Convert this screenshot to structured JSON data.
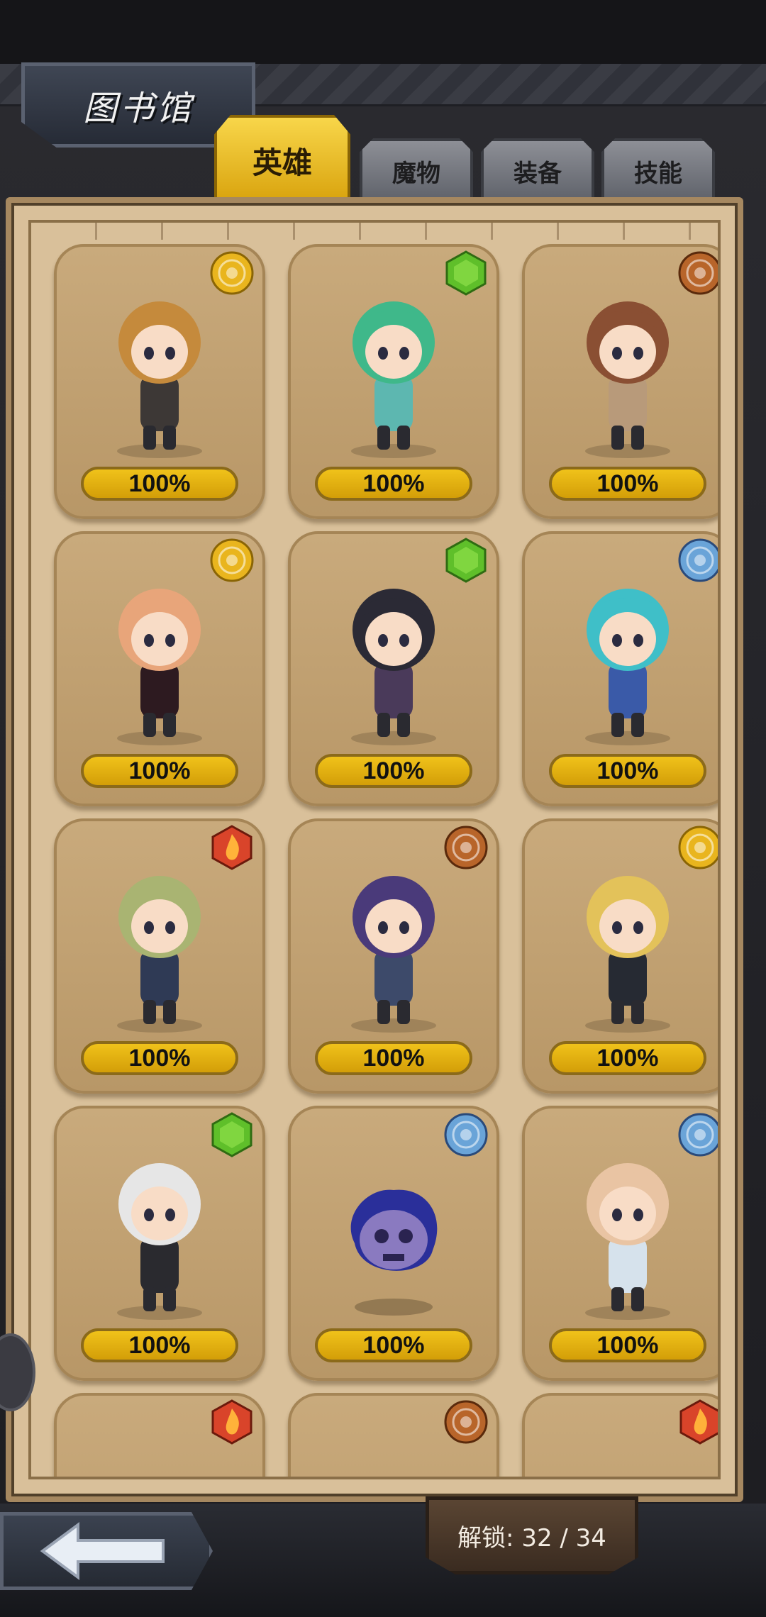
{
  "header": {
    "title": "图书馆"
  },
  "tabs": [
    {
      "label": "英雄",
      "active": true
    },
    {
      "label": "魔物",
      "active": false
    },
    {
      "label": "装备",
      "active": false
    },
    {
      "label": "技能",
      "active": false
    }
  ],
  "colors": {
    "gold": "#f0c21a",
    "green": "#5fbf2a",
    "bronze": "#b8652a",
    "blue": "#6aa4d8",
    "red": "#d9442a",
    "parchment": "#d9c09a"
  },
  "cards": [
    {
      "emblem": "gold-sun-emblem-icon",
      "emblem_color": "#e9b51e",
      "character": "swordsman-brown-hair",
      "hair": "#c58a3c",
      "outfit": "#3d3836",
      "progress": "100%"
    },
    {
      "emblem": "green-gem-emblem-icon",
      "emblem_color": "#5fbf2a",
      "character": "green-haired-mage",
      "hair": "#3fb88a",
      "outfit": "#5db7b0",
      "progress": "100%"
    },
    {
      "emblem": "bronze-star-emblem-icon",
      "emblem_color": "#b8652a",
      "character": "shield-maiden",
      "hair": "#8a4f33",
      "outfit": "#b89a7a",
      "progress": "100%"
    },
    {
      "emblem": "gold-sun-emblem-icon",
      "emblem_color": "#e9b51e",
      "character": "alchemist-girl",
      "hair": "#e8a57a",
      "outfit": "#2d1a20",
      "progress": "100%"
    },
    {
      "emblem": "green-gem-emblem-icon",
      "emblem_color": "#5fbf2a",
      "character": "crossbow-archer",
      "hair": "#2b2a35",
      "outfit": "#4a3a5a",
      "progress": "100%"
    },
    {
      "emblem": "blue-snowflake-emblem-icon",
      "emblem_color": "#6aa4d8",
      "character": "ice-staff-mage",
      "hair": "#3fbfc8",
      "outfit": "#3a5aa8",
      "progress": "100%"
    },
    {
      "emblem": "red-flame-emblem-icon",
      "emblem_color": "#d9442a",
      "character": "green-haired-rogue",
      "hair": "#a9b472",
      "outfit": "#2f3a55",
      "progress": "100%"
    },
    {
      "emblem": "bronze-star-emblem-icon",
      "emblem_color": "#b8652a",
      "character": "samurai",
      "hair": "#4a3a7a",
      "outfit": "#3d4a6a",
      "progress": "100%"
    },
    {
      "emblem": "gold-sun-emblem-icon",
      "emblem_color": "#e9b51e",
      "character": "blonde-noble",
      "hair": "#e3c25a",
      "outfit": "#262a33",
      "progress": "100%"
    },
    {
      "emblem": "green-gem-emblem-icon",
      "emblem_color": "#5fbf2a",
      "character": "shadow-knight",
      "hair": "#e6e6e6",
      "outfit": "#2a2a2f",
      "progress": "100%"
    },
    {
      "emblem": "blue-snowflake-emblem-icon",
      "emblem_color": "#6aa4d8",
      "character": "skull-spirit",
      "hair": "#2a2f9a",
      "outfit": "#8a7ac0",
      "progress": "100%"
    },
    {
      "emblem": "blue-snowflake-emblem-icon",
      "emblem_color": "#6aa4d8",
      "character": "blonde-swordswoman",
      "hair": "#e9c4a3",
      "outfit": "#d6e2ec",
      "progress": "100%"
    },
    {
      "emblem": "red-flame-emblem-icon",
      "emblem_color": "#d9442a",
      "character": "partial-hero-1",
      "hair": "#e6d08a",
      "outfit": "#b89767",
      "progress": ""
    },
    {
      "emblem": "bronze-star-emblem-icon",
      "emblem_color": "#b8652a",
      "character": "partial-hero-2",
      "hair": "#6ab0c8",
      "outfit": "#b89767",
      "progress": ""
    },
    {
      "emblem": "red-flame-emblem-icon",
      "emblem_color": "#d9442a",
      "character": "partial-hero-3",
      "hair": "#b89767",
      "outfit": "#b89767",
      "progress": ""
    }
  ],
  "footer": {
    "back_icon": "back-arrow-icon",
    "unlock_text": "解锁: 32 / 34"
  }
}
